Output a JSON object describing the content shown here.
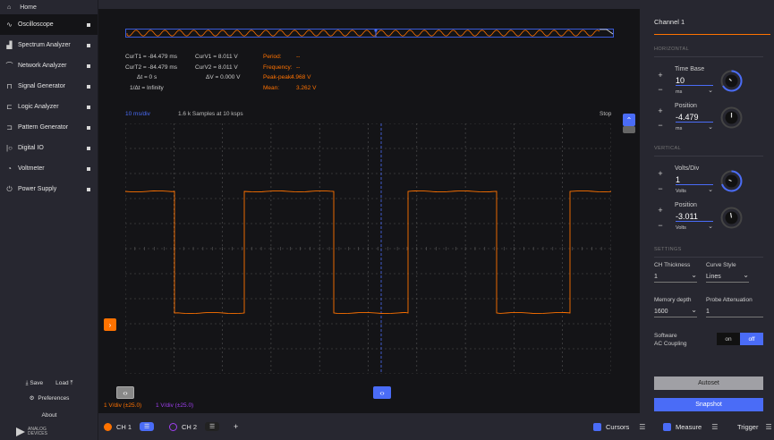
{
  "sidebar": {
    "home": "Home",
    "items": [
      {
        "label": "Oscilloscope",
        "icon": "oscilloscope-icon",
        "active": true
      },
      {
        "label": "Spectrum Analyzer",
        "icon": "spectrum-icon"
      },
      {
        "label": "Network Analyzer",
        "icon": "network-icon"
      },
      {
        "label": "Signal Generator",
        "icon": "signal-icon"
      },
      {
        "label": "Logic Analyzer",
        "icon": "logic-icon"
      },
      {
        "label": "Pattern Generator",
        "icon": "pattern-icon"
      },
      {
        "label": "Digital IO",
        "icon": "digital-io-icon"
      },
      {
        "label": "Voltmeter",
        "icon": "voltmeter-icon"
      },
      {
        "label": "Power Supply",
        "icon": "power-icon"
      }
    ],
    "save": "Save",
    "load": "Load",
    "preferences": "Preferences",
    "about": "About",
    "logo_line1": "ANALOG",
    "logo_line2": "DEVICES"
  },
  "readouts": {
    "curt1": "CurT1 = -84.479 ms",
    "curt2": "CurT2 = -84.479 ms",
    "dt": "Δt = 0 s",
    "inv_dt": "1/Δt = Infinity",
    "curv1": "CurV1 = 8.011 V",
    "curv2": "CurV2 = 8.011 V",
    "dv": "ΔV = 0.000 V",
    "period_label": "Period:",
    "period_value": "--",
    "frequency_label": "Frequency:",
    "frequency_value": "--",
    "peak_label": "Peak-peak:",
    "peak_value": "4.968 V",
    "mean_label": "Mean:",
    "mean_value": "3.262 V"
  },
  "plot": {
    "time_div": "10 ms/div",
    "samples": "1.6 k Samples at 10 ksps",
    "status": "Stop",
    "ch1_scale": "1 V/div (±25.0)",
    "ch2_scale": "1 V/div (±25.0)"
  },
  "panel": {
    "title": "Channel 1",
    "horizontal": "HORIZONTAL",
    "timebase_label": "Time Base",
    "timebase_value": "10",
    "timebase_unit": "ms",
    "hpos_label": "Position",
    "hpos_value": "-4.479",
    "hpos_unit": "ms",
    "vertical": "VERTICAL",
    "voltsdiv_label": "Volts/Div",
    "voltsdiv_value": "1",
    "voltsdiv_unit": "Volts",
    "vpos_label": "Position",
    "vpos_value": "-3.011",
    "vpos_unit": "Volts",
    "settings": "SETTINGS",
    "thickness_label": "CH Thickness",
    "thickness_value": "1",
    "curve_label": "Curve Style",
    "curve_value": "Lines",
    "memory_label": "Memory depth",
    "memory_value": "1600",
    "probe_label": "Probe Attenuation",
    "probe_value": "1",
    "ac_label1": "Software",
    "ac_label2": "AC Coupling",
    "on": "on",
    "off": "off",
    "autoset": "Autoset",
    "snapshot": "Snapshot"
  },
  "bottom": {
    "ch1": "CH 1",
    "ch2": "CH 2",
    "add": "+",
    "cursors": "Cursors",
    "measure": "Measure",
    "trigger": "Trigger"
  },
  "colors": {
    "ch1": "#ff7200",
    "ch2": "#9f3ff0",
    "accent": "#4a6cf7"
  }
}
